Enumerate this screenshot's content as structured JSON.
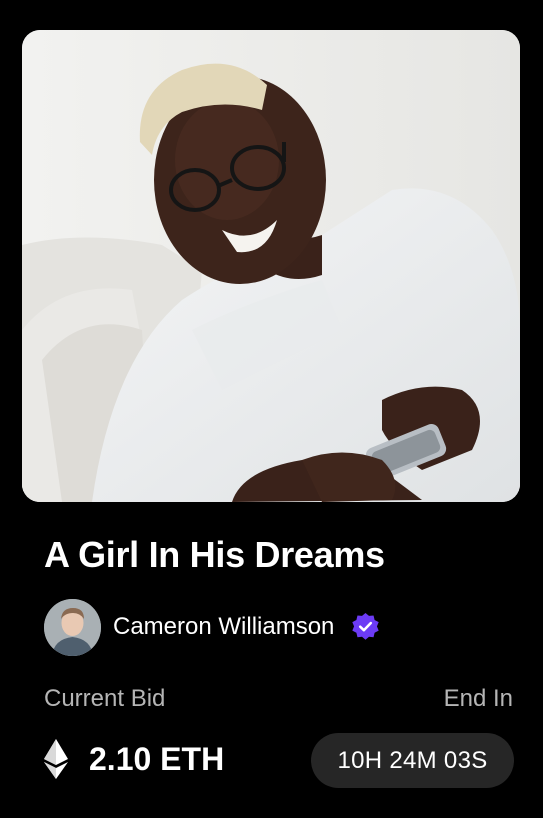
{
  "nft": {
    "title": "A Girl In His Dreams",
    "image_icon": "nft-artwork-photo"
  },
  "creator": {
    "name": "Cameron Williamson",
    "avatar_icon": "creator-avatar",
    "verified_icon": "verified-badge-icon"
  },
  "bid": {
    "label": "Current Bid",
    "value": "2.10 ETH",
    "currency_icon": "ethereum-icon"
  },
  "auction": {
    "label": "End In",
    "countdown": "10H 24M 03S"
  },
  "colors": {
    "background": "#000000",
    "text": "#ffffff",
    "muted": "#b5b5b5",
    "timer_bg": "#262626",
    "verified": "#6c3bf5"
  }
}
